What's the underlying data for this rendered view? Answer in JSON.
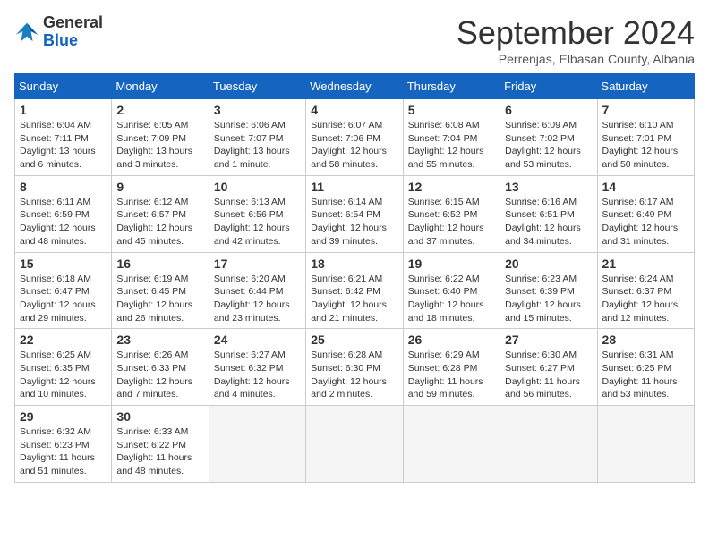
{
  "logo": {
    "general": "General",
    "blue": "Blue"
  },
  "title": "September 2024",
  "subtitle": "Perrenjas, Elbasan County, Albania",
  "weekdays": [
    "Sunday",
    "Monday",
    "Tuesday",
    "Wednesday",
    "Thursday",
    "Friday",
    "Saturday"
  ],
  "weeks": [
    [
      {
        "day": 1,
        "info": "Sunrise: 6:04 AM\nSunset: 7:11 PM\nDaylight: 13 hours\nand 6 minutes."
      },
      {
        "day": 2,
        "info": "Sunrise: 6:05 AM\nSunset: 7:09 PM\nDaylight: 13 hours\nand 3 minutes."
      },
      {
        "day": 3,
        "info": "Sunrise: 6:06 AM\nSunset: 7:07 PM\nDaylight: 13 hours\nand 1 minute."
      },
      {
        "day": 4,
        "info": "Sunrise: 6:07 AM\nSunset: 7:06 PM\nDaylight: 12 hours\nand 58 minutes."
      },
      {
        "day": 5,
        "info": "Sunrise: 6:08 AM\nSunset: 7:04 PM\nDaylight: 12 hours\nand 55 minutes."
      },
      {
        "day": 6,
        "info": "Sunrise: 6:09 AM\nSunset: 7:02 PM\nDaylight: 12 hours\nand 53 minutes."
      },
      {
        "day": 7,
        "info": "Sunrise: 6:10 AM\nSunset: 7:01 PM\nDaylight: 12 hours\nand 50 minutes."
      }
    ],
    [
      {
        "day": 8,
        "info": "Sunrise: 6:11 AM\nSunset: 6:59 PM\nDaylight: 12 hours\nand 48 minutes."
      },
      {
        "day": 9,
        "info": "Sunrise: 6:12 AM\nSunset: 6:57 PM\nDaylight: 12 hours\nand 45 minutes."
      },
      {
        "day": 10,
        "info": "Sunrise: 6:13 AM\nSunset: 6:56 PM\nDaylight: 12 hours\nand 42 minutes."
      },
      {
        "day": 11,
        "info": "Sunrise: 6:14 AM\nSunset: 6:54 PM\nDaylight: 12 hours\nand 39 minutes."
      },
      {
        "day": 12,
        "info": "Sunrise: 6:15 AM\nSunset: 6:52 PM\nDaylight: 12 hours\nand 37 minutes."
      },
      {
        "day": 13,
        "info": "Sunrise: 6:16 AM\nSunset: 6:51 PM\nDaylight: 12 hours\nand 34 minutes."
      },
      {
        "day": 14,
        "info": "Sunrise: 6:17 AM\nSunset: 6:49 PM\nDaylight: 12 hours\nand 31 minutes."
      }
    ],
    [
      {
        "day": 15,
        "info": "Sunrise: 6:18 AM\nSunset: 6:47 PM\nDaylight: 12 hours\nand 29 minutes."
      },
      {
        "day": 16,
        "info": "Sunrise: 6:19 AM\nSunset: 6:45 PM\nDaylight: 12 hours\nand 26 minutes."
      },
      {
        "day": 17,
        "info": "Sunrise: 6:20 AM\nSunset: 6:44 PM\nDaylight: 12 hours\nand 23 minutes."
      },
      {
        "day": 18,
        "info": "Sunrise: 6:21 AM\nSunset: 6:42 PM\nDaylight: 12 hours\nand 21 minutes."
      },
      {
        "day": 19,
        "info": "Sunrise: 6:22 AM\nSunset: 6:40 PM\nDaylight: 12 hours\nand 18 minutes."
      },
      {
        "day": 20,
        "info": "Sunrise: 6:23 AM\nSunset: 6:39 PM\nDaylight: 12 hours\nand 15 minutes."
      },
      {
        "day": 21,
        "info": "Sunrise: 6:24 AM\nSunset: 6:37 PM\nDaylight: 12 hours\nand 12 minutes."
      }
    ],
    [
      {
        "day": 22,
        "info": "Sunrise: 6:25 AM\nSunset: 6:35 PM\nDaylight: 12 hours\nand 10 minutes."
      },
      {
        "day": 23,
        "info": "Sunrise: 6:26 AM\nSunset: 6:33 PM\nDaylight: 12 hours\nand 7 minutes."
      },
      {
        "day": 24,
        "info": "Sunrise: 6:27 AM\nSunset: 6:32 PM\nDaylight: 12 hours\nand 4 minutes."
      },
      {
        "day": 25,
        "info": "Sunrise: 6:28 AM\nSunset: 6:30 PM\nDaylight: 12 hours\nand 2 minutes."
      },
      {
        "day": 26,
        "info": "Sunrise: 6:29 AM\nSunset: 6:28 PM\nDaylight: 11 hours\nand 59 minutes."
      },
      {
        "day": 27,
        "info": "Sunrise: 6:30 AM\nSunset: 6:27 PM\nDaylight: 11 hours\nand 56 minutes."
      },
      {
        "day": 28,
        "info": "Sunrise: 6:31 AM\nSunset: 6:25 PM\nDaylight: 11 hours\nand 53 minutes."
      }
    ],
    [
      {
        "day": 29,
        "info": "Sunrise: 6:32 AM\nSunset: 6:23 PM\nDaylight: 11 hours\nand 51 minutes."
      },
      {
        "day": 30,
        "info": "Sunrise: 6:33 AM\nSunset: 6:22 PM\nDaylight: 11 hours\nand 48 minutes."
      },
      null,
      null,
      null,
      null,
      null
    ]
  ]
}
